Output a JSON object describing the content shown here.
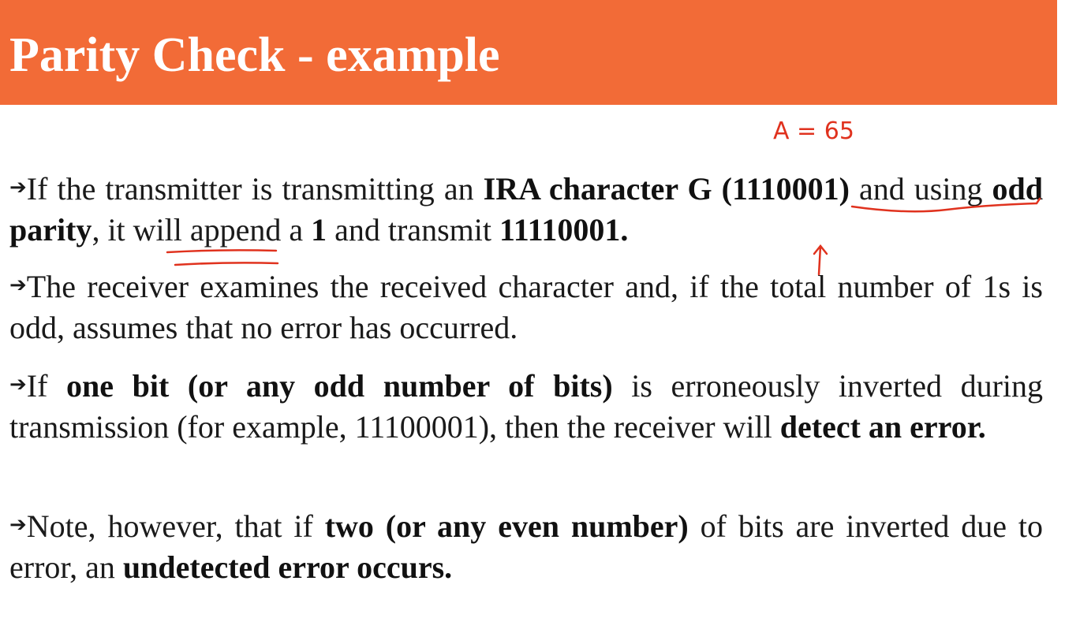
{
  "slide": {
    "title": "Parity Check - example",
    "bullet_icon": "arrow-right",
    "ink_color": "#e0321e",
    "annotation_note": "A = 65",
    "paragraphs": [
      {
        "segments": [
          {
            "text": "If the transmitter is transmitting an ",
            "bold": false
          },
          {
            "text": "IRA character G (1110001)",
            "bold": true
          },
          {
            "text": " and using ",
            "bold": false
          },
          {
            "text": "odd parity",
            "bold": true
          },
          {
            "text": ", it will append a ",
            "bold": false
          },
          {
            "text": "1",
            "bold": true
          },
          {
            "text": " and transmit ",
            "bold": false
          },
          {
            "text": "11110001.",
            "bold": true
          }
        ]
      },
      {
        "segments": [
          {
            "text": "The receiver examines the received character and, if the total number of 1s is odd, assumes that no error has occurred.",
            "bold": false
          }
        ]
      },
      {
        "segments": [
          {
            "text": "If ",
            "bold": false
          },
          {
            "text": "one bit (or any odd number of bits)",
            "bold": true
          },
          {
            "text": " is erroneously inverted during transmission (for example, 11100001), then the receiver will ",
            "bold": false
          },
          {
            "text": "detect an error.",
            "bold": true
          }
        ]
      },
      {
        "segments": [
          {
            "text": "Note, however, that if ",
            "bold": false
          },
          {
            "text": "two (or any even number)",
            "bold": true
          },
          {
            "text": " of bits are inverted due to error, an ",
            "bold": false
          },
          {
            "text": "undetected error occurs.",
            "bold": true
          }
        ]
      }
    ]
  }
}
